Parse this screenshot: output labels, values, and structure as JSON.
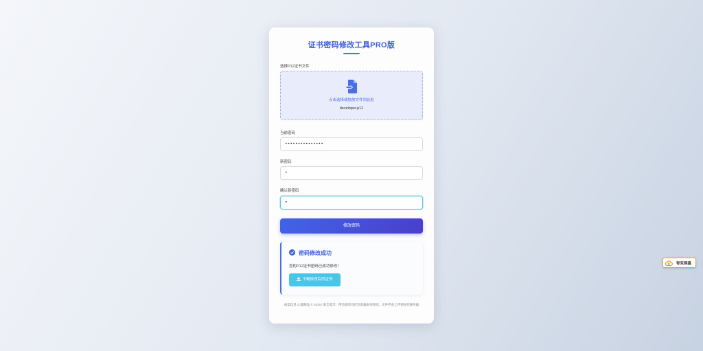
{
  "card": {
    "title": "证书密码修改工具PRO版"
  },
  "file_section": {
    "label": "选择P12证书文件",
    "drop_hint": "点击选择或拖放文件到此处",
    "selected_file": "developer.p12",
    "icon": "file-import-icon"
  },
  "fields": {
    "current_password": {
      "label": "当前密码",
      "value": "•••••••••••••••"
    },
    "new_password": {
      "label": "新密码",
      "value": "•"
    },
    "confirm_password": {
      "label": "确认新密码",
      "value": "•"
    }
  },
  "submit_label": "修改密码",
  "success": {
    "icon": "check-circle-icon",
    "title": "密码修改成功",
    "message": "您的P12证书密码已成功修改！",
    "download_label": "下载修改后的证书",
    "download_icon": "download-icon"
  },
  "footer": {
    "text": "备案信息 心理精品 © 2026 | 安全提示：所有操作均在浏览器本地完成，文件不会上传到任何服务器"
  },
  "extension": {
    "label": "夸克网盘",
    "icon": "cloud-icon"
  },
  "colors": {
    "accent": "#3d5fd8",
    "button_gradient_start": "#4263e6",
    "button_gradient_end": "#4a3fcc",
    "download_button": "#47c6e8",
    "focus_border": "#5ec7d6"
  }
}
